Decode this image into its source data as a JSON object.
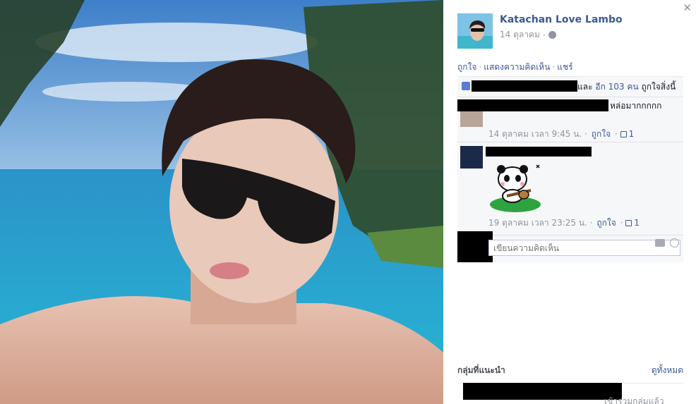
{
  "photo": {
    "alt": ""
  },
  "post": {
    "author": "Katachan Love Lambo",
    "date": "14 ตุลาคม",
    "separator": "·"
  },
  "actions": {
    "like": "ถูกใจ",
    "comment": "แสดงความคิดเห็น",
    "share": "แชร์"
  },
  "likes": {
    "connector": "และ",
    "others": "อีก 103 คน",
    "suffix": "ถูกใจสิ่งนี้"
  },
  "comments": [
    {
      "text": "หล่อมากกกกก",
      "meta": "14 ตุลาคม เวลา 9:45 น.",
      "like_label": "ถูกใจ",
      "like_count": "1"
    },
    {
      "text": "",
      "meta": "19 ตุลาคม เวลา 23:25 น.",
      "like_label": "ถูกใจ",
      "like_count": "1"
    }
  ],
  "reply": {
    "placeholder": "เขียนความคิดเห็น"
  },
  "groups": {
    "title": "กลุ่มที่แนะนำ",
    "see_all": "ดูทั้งหมด",
    "row_text": "เข้าร่วมกลุ่มแล้ว"
  },
  "icons": {
    "close": "close-icon",
    "globe": "globe-icon",
    "thumb": "thumbs-up-icon",
    "camera": "camera-icon",
    "smile": "smile-icon"
  }
}
